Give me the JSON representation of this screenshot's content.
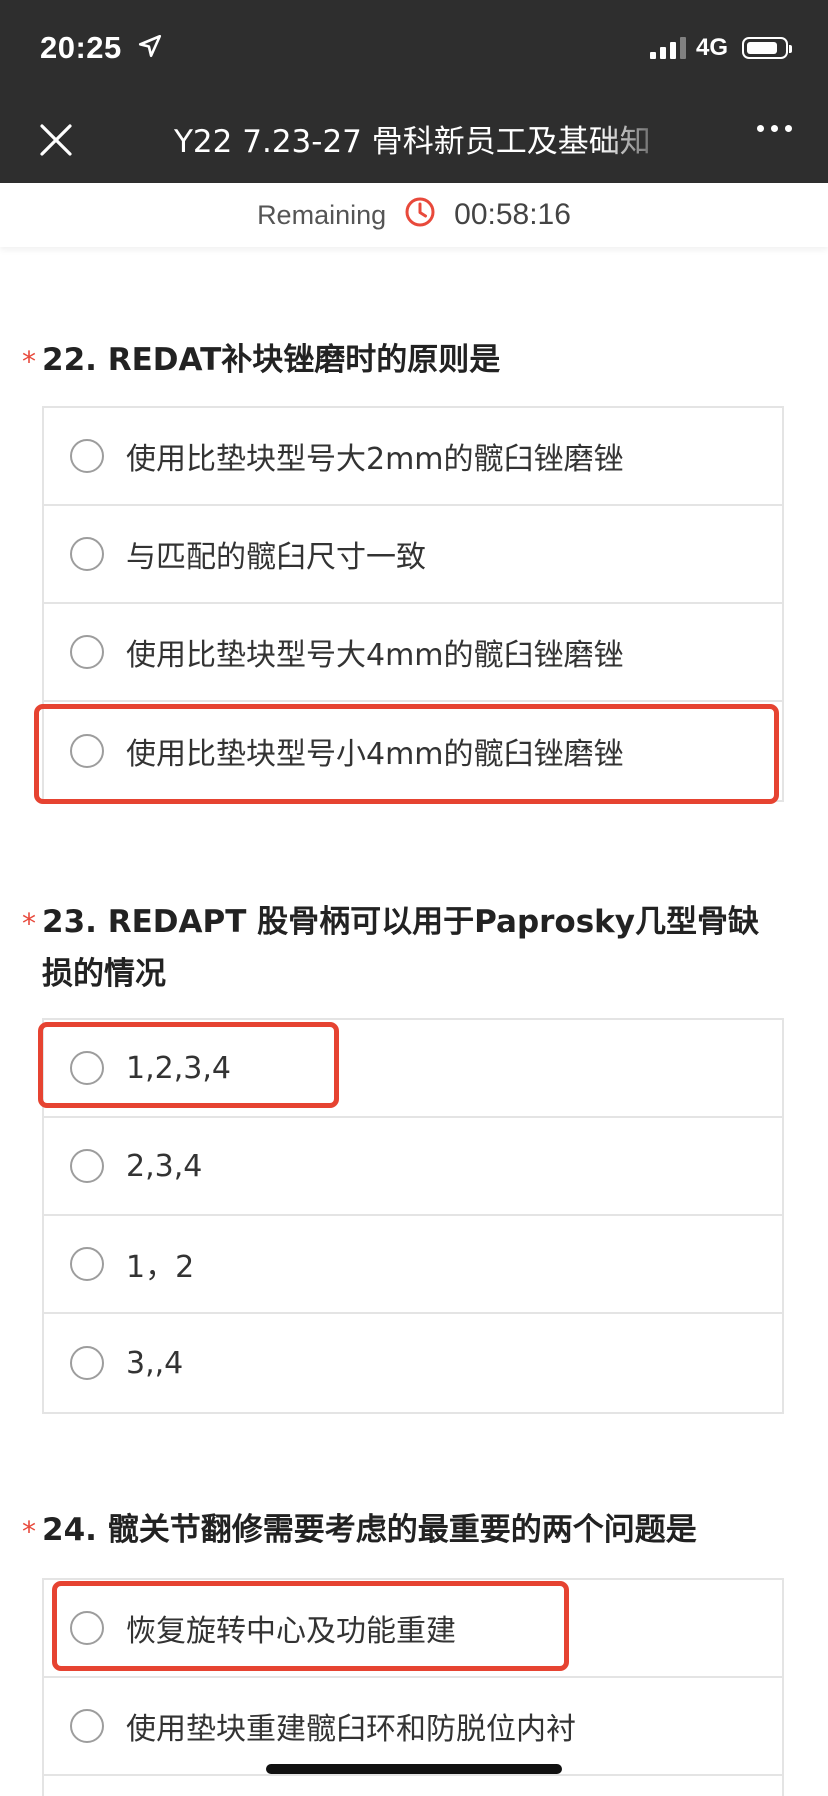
{
  "status_bar": {
    "time": "20:25",
    "network": "4G",
    "battery_percent": 80
  },
  "header": {
    "title": "Y22 7.23-27 骨科新员工及基础知"
  },
  "timer": {
    "label": "Remaining",
    "value": "00:58:16"
  },
  "questions": [
    {
      "number_title": "22. REDAT补块锉磨时的原则是",
      "options": [
        "使用比垫块型号大2mm的髋臼锉磨锉",
        "与匹配的髋臼尺寸一致",
        "使用比垫块型号大4mm的髋臼锉磨锉",
        "使用比垫块型号小4mm的髋臼锉磨锉"
      ]
    },
    {
      "number_title": "23. REDAPT 股骨柄可以用于Paprosky几型骨缺损的情况",
      "options": [
        "1,2,3,4",
        "2,3,4",
        "1，2",
        "3,,4"
      ]
    },
    {
      "number_title": "24. 髋关节翻修需要考虑的最重要的两个问题是",
      "options": [
        "恢复旋转中心及功能重建",
        "使用垫块重建髋臼环和防脱位内衬"
      ]
    }
  ],
  "required_marker": "*",
  "colors": {
    "header_bg": "#2e2e2e",
    "accent_red": "#e64331",
    "timer_icon": "#e8493b"
  }
}
